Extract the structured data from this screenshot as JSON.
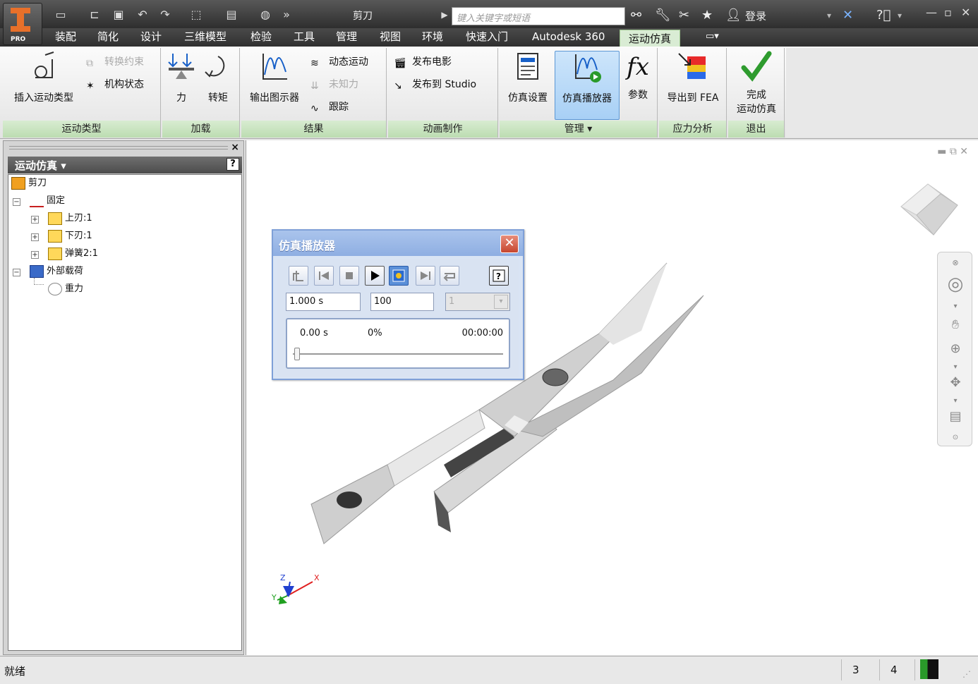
{
  "app": {
    "badge": "PRO",
    "document_title": "剪刀",
    "search_placeholder": "键入关键字或短语",
    "login_label": "登录"
  },
  "tabs": [
    "装配",
    "简化",
    "设计",
    "三维模型",
    "检验",
    "工具",
    "管理",
    "视图",
    "环境",
    "快速入门",
    "Autodesk 360",
    "运动仿真"
  ],
  "active_tab": "运动仿真",
  "ribbon": {
    "motion_types": {
      "title": "运动类型",
      "insert": "插入运动类型",
      "convert": "转换约束",
      "mech_status": "机构状态"
    },
    "loads": {
      "title": "加载",
      "force": "力",
      "torque": "转矩"
    },
    "results": {
      "title": "结果",
      "output_grapher": "输出图示器",
      "dynamic_motion": "动态运动",
      "unknown_force": "未知力",
      "trace": "跟踪"
    },
    "animation": {
      "title": "动画制作",
      "publish_movie": "发布电影",
      "publish_studio": "发布到 Studio"
    },
    "manage": {
      "title": "管理",
      "sim_settings": "仿真设置",
      "sim_player": "仿真播放器",
      "parameters": "参数"
    },
    "stress": {
      "title": "应力分析",
      "export_fea": "导出到 FEA"
    },
    "exit": {
      "title": "退出",
      "finish_line1": "完成",
      "finish_line2": "运动仿真"
    }
  },
  "browser": {
    "header": "运动仿真",
    "tree": [
      {
        "label": "剪刀"
      },
      {
        "label": "固定"
      },
      {
        "label": "上刃:1"
      },
      {
        "label": "下刃:1"
      },
      {
        "label": "弹簧2:1"
      },
      {
        "label": "外部载荷"
      },
      {
        "label": "重力"
      }
    ]
  },
  "sim_player": {
    "title": "仿真播放器",
    "end_time": "1.000 s",
    "image_count": "100",
    "filter_value": "1",
    "current_time": "0.00 s",
    "percent": "0%",
    "elapsed": "00:00:00",
    "progress": 0
  },
  "triad": {
    "x": "X",
    "y": "Y",
    "z": "Z"
  },
  "status": {
    "text": "就绪",
    "num1": "3",
    "num2": "4"
  },
  "colors": {
    "ribbon_panel_title": "#c6e2bc",
    "active_button": "#a8d0f5",
    "dialog_title": "#8eaee2",
    "close_button": "#c6452e"
  }
}
